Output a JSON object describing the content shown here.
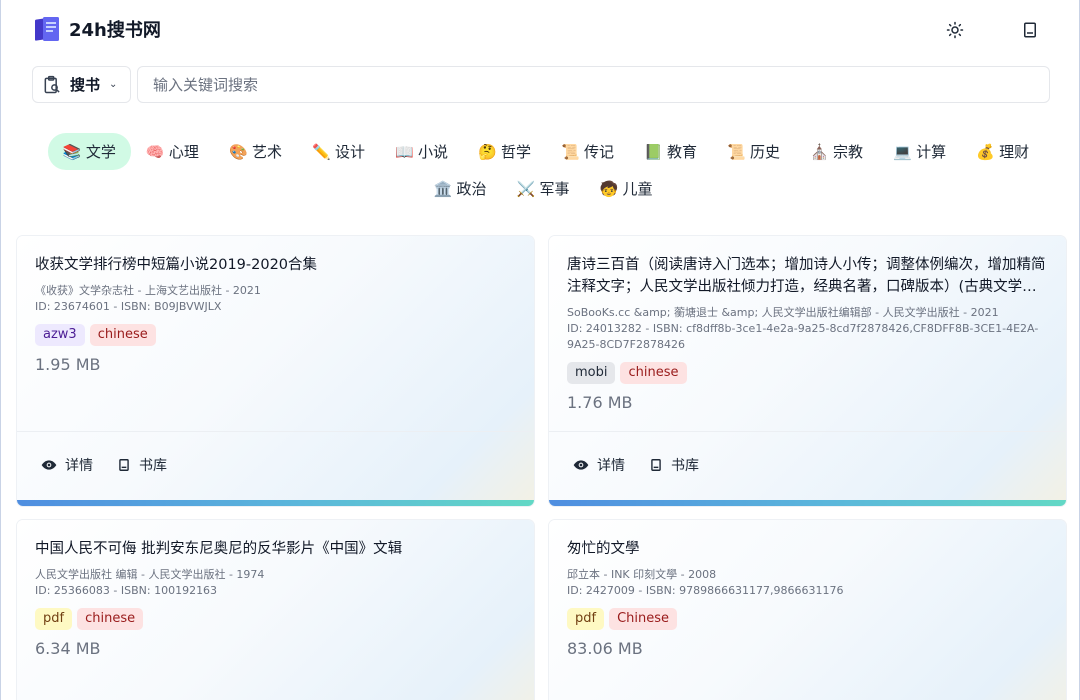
{
  "app": {
    "name": "24h搜书网",
    "icons": {
      "theme": "sun-icon",
      "library": "book-icon"
    }
  },
  "search": {
    "mode_label": "搜书",
    "placeholder": "输入关键词搜索",
    "value": ""
  },
  "categories": [
    {
      "label": "文学",
      "icon": "📚",
      "active": true
    },
    {
      "label": "心理",
      "icon": "🧠"
    },
    {
      "label": "艺术",
      "icon": "🎨"
    },
    {
      "label": "设计",
      "icon": "✏️"
    },
    {
      "label": "小说",
      "icon": "📖"
    },
    {
      "label": "哲学",
      "icon": "🤔"
    },
    {
      "label": "传记",
      "icon": "📜"
    },
    {
      "label": "教育",
      "icon": "📗"
    },
    {
      "label": "历史",
      "icon": "📜"
    },
    {
      "label": "宗教",
      "icon": "⛪"
    },
    {
      "label": "计算",
      "icon": "💻"
    },
    {
      "label": "理财",
      "icon": "💰"
    },
    {
      "label": "政治",
      "icon": "🏛️"
    },
    {
      "label": "军事",
      "icon": "⚔️"
    },
    {
      "label": "儿童",
      "icon": "🧒"
    }
  ],
  "actions": {
    "details": "详情",
    "library": "书库"
  },
  "books": [
    {
      "title": "收获文学排行榜中短篇小说2019-2020合集",
      "meta1": "《收获》文学杂志社 - 上海文艺出版社 - 2021",
      "meta2": "ID: 23674601 - ISBN: B09JBVWJLX",
      "format": "azw3",
      "language": "chinese",
      "size": "1.95 MB"
    },
    {
      "title": "唐诗三百首（阅读唐诗入门选本；增加诗人小传；调整体例编次，增加精简注释文字；人民文学出版社倾力打造，经典名著，口碑版本）(古典文学大字本)",
      "meta1": "SoBooKs.cc &amp; 蘅塘退士 &amp; 人民文学出版社编辑部 - 人民文学出版社 - 2021",
      "meta2": "ID: 24013282 - ISBN: cf8dff8b-3ce1-4e2a-9a25-8cd7f2878426,CF8DFF8B-3CE1-4E2A-9A25-8CD7F2878426",
      "format": "mobi",
      "language": "chinese",
      "size": "1.76 MB"
    },
    {
      "title": "中国人民不可侮 批判安东尼奥尼的反华影片《中国》文辑",
      "meta1": "人民文学出版社 编辑 - 人民文学出版社 - 1974",
      "meta2": "ID: 25366083 - ISBN: 100192163",
      "format": "pdf",
      "language": "chinese",
      "size": "6.34 MB"
    },
    {
      "title": "匆忙的文學",
      "meta1": "邱立本 - INK 印刻文學 - 2008",
      "meta2": "ID: 2427009 - ISBN: 9789866631177,9866631176",
      "format": "pdf",
      "language": "Chinese",
      "size": "83.06 MB"
    }
  ]
}
